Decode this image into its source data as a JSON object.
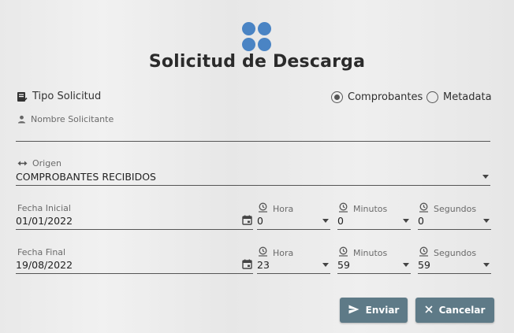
{
  "header": {
    "title": "Solicitud de Descarga",
    "logo_icon": "four-dots-logo",
    "accent": "#4a84c4"
  },
  "tipo_solicitud": {
    "label": "Tipo Solicitud",
    "icon": "document-check-icon",
    "options": [
      {
        "label": "Comprobantes",
        "selected": true
      },
      {
        "label": "Metadata",
        "selected": false
      }
    ]
  },
  "nombre_solicitante": {
    "label": "Nombre Solicitante",
    "icon": "person-icon",
    "value": ""
  },
  "origen": {
    "label": "Origen",
    "icon": "swap-horizontal-icon",
    "value": "COMPROBANTES RECIBIDOS"
  },
  "fecha_inicial": {
    "label": "Fecha Inicial",
    "value": "01/01/2022",
    "hora": {
      "label": "Hora",
      "value": "0"
    },
    "minutos": {
      "label": "Minutos",
      "value": "0"
    },
    "segundos": {
      "label": "Segundos",
      "value": "0"
    }
  },
  "fecha_final": {
    "label": "Fecha Final",
    "value": "19/08/2022",
    "hora": {
      "label": "Hora",
      "value": "23"
    },
    "minutos": {
      "label": "Minutos",
      "value": "59"
    },
    "segundos": {
      "label": "Segundos",
      "value": "59"
    }
  },
  "actions": {
    "enviar_label": "Enviar",
    "enviar_icon": "send-icon",
    "cancelar_label": "Cancelar",
    "cancelar_icon": "close-icon",
    "button_color": "#5e7a87"
  }
}
